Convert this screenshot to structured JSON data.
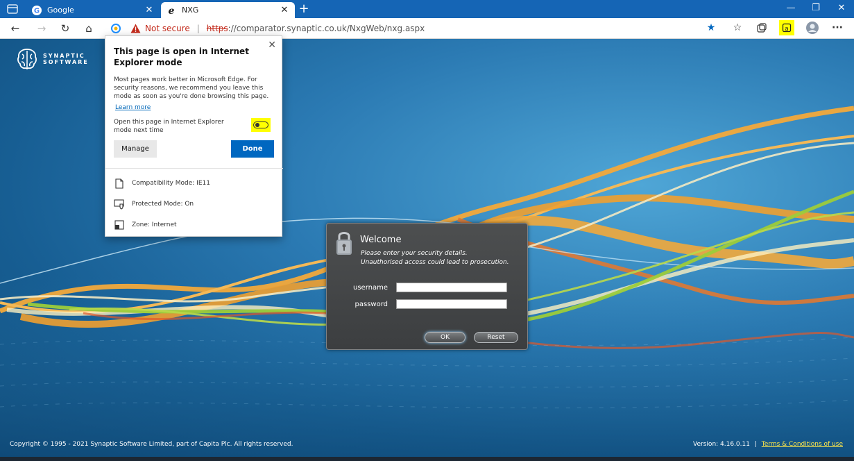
{
  "browser": {
    "tabs": [
      {
        "title": "Google",
        "active": false
      },
      {
        "title": "NXG",
        "active": true
      }
    ],
    "address": {
      "not_secure": "Not secure",
      "separator": "|",
      "scheme": "https",
      "url_rest": "://comparator.synaptic.co.uk/NxgWeb/nxg.aspx"
    },
    "colors": {
      "titlebar": "#1565b5",
      "highlight": "#ffff00"
    }
  },
  "ie_popup": {
    "title": "This page is open in Internet Explorer mode",
    "body": "Most pages work better in Microsoft Edge. For security reasons, we recommend you leave this mode as soon as you're done browsing this page.",
    "learn_more": "Learn more",
    "open_next_time": "Open this page in Internet Explorer mode next time",
    "manage": "Manage",
    "done": "Done",
    "compat_mode": "Compatibility Mode: IE11",
    "protected_mode": "Protected Mode: On",
    "zone": "Zone: Internet"
  },
  "login": {
    "title": "Welcome",
    "line1": "Please enter your security details.",
    "line2": "Unauthorised access could lead to prosecution.",
    "username_label": "username",
    "password_label": "password",
    "username_value": "",
    "password_value": "",
    "ok": "OK",
    "reset": "Reset"
  },
  "brand": {
    "line1": "SYNAPTIC",
    "line2": "SOFTWARE"
  },
  "footer": {
    "copyright": "Copyright © 1995 - 2021 Synaptic Software Limited, part of Capita Plc. All rights reserved.",
    "version": "Version: 4.16.0.11",
    "sep": "|",
    "terms": "Terms & Conditions of use"
  }
}
